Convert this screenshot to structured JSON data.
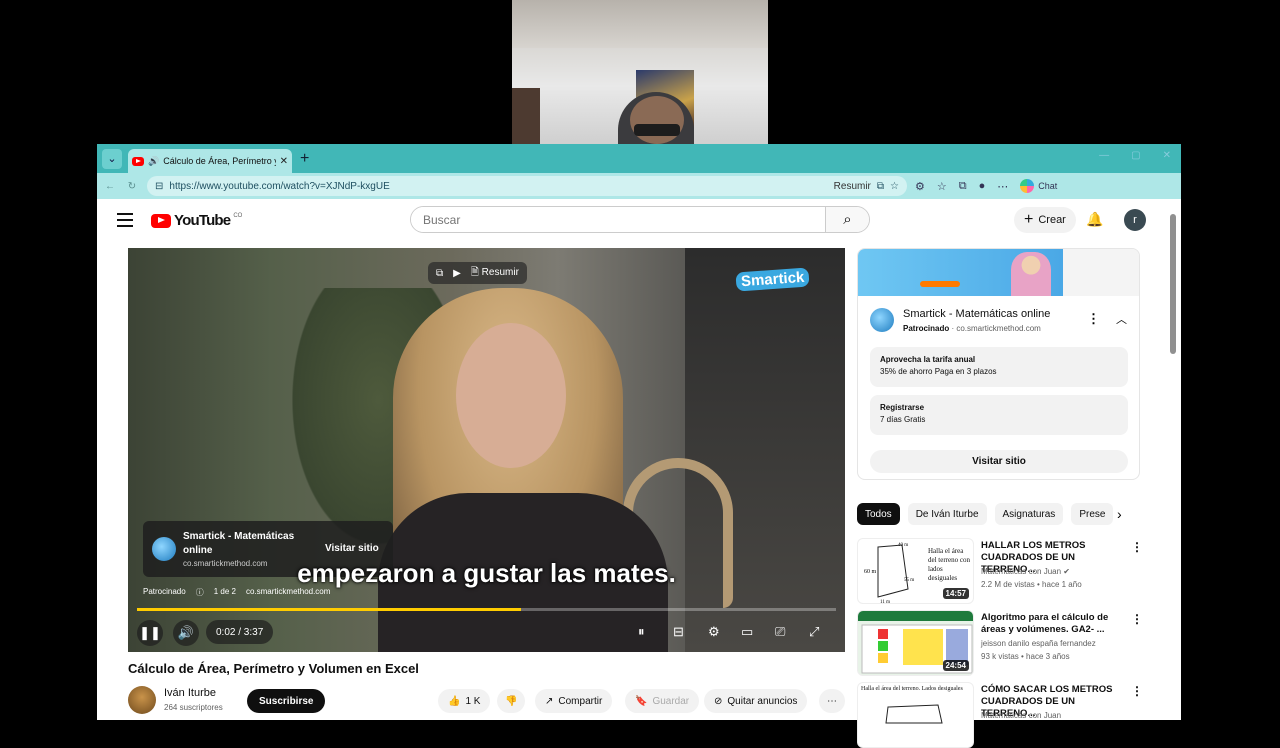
{
  "browser": {
    "tab_title": "Cálculo de Área, Perímetro y V",
    "url": "https://www.youtube.com/watch?v=XJNdP-kxgUE",
    "resumir": "Resumir",
    "chat": "Chat"
  },
  "header": {
    "logo": "YouTube",
    "logo_country": "CO",
    "search_placeholder": "Buscar",
    "create": "Crear",
    "avatar_letter": "r"
  },
  "player": {
    "overlay_resumir": "Resumir",
    "brand_logo": "Smartick",
    "ad_card": {
      "name": "Smartick - Matemáticas online",
      "url": "co.smartickmethod.com",
      "visit": "Visitar sitio"
    },
    "subtitle": "empezaron a gustar las mates.",
    "ad_info": {
      "sponsored": "Patrocinado",
      "count": "1 de 2",
      "url": "co.smartickmethod.com"
    },
    "time": "0:02 / 3:37",
    "progress": 0.55
  },
  "video": {
    "title": "Cálculo de Área, Perímetro y Volumen en Excel",
    "channel": "Iván Iturbe",
    "subscribers": "264 suscriptores",
    "subscribe": "Suscribirse",
    "likes": "1 K",
    "share": "Compartir",
    "save": "Guardar",
    "remove_ads": "Quitar anuncios"
  },
  "ad_panel": {
    "title": "Smartick - Matemáticas online",
    "sponsored": "Patrocinado",
    "url": "co.smartickmethod.com",
    "offers": [
      {
        "title": "Aprovecha la tarifa anual",
        "desc": "35% de ahorro Paga en 3 plazos"
      },
      {
        "title": "Registrarse",
        "desc": "7 días Gratis"
      }
    ],
    "visit": "Visitar sitio"
  },
  "chips": [
    "Todos",
    "De Iván Iturbe",
    "Asignaturas",
    "Prese"
  ],
  "recommendations": [
    {
      "title": "HALLAR LOS METROS CUADRADOS DE UN TERRENO...",
      "channel": "Matemáticas con Juan",
      "meta": "2.2 M de vistas • hace 1 año",
      "duration": "14:57"
    },
    {
      "title": "Algoritmo para el cálculo de áreas y volúmenes. GA2- ...",
      "channel": "jeisson danilo españa fernandez",
      "meta": "93 k vistas • hace 3 años",
      "duration": "24:54"
    },
    {
      "title": "CÓMO SACAR LOS METROS CUADRADOS DE UN TERRENO...",
      "channel": "Matemáticas con Juan",
      "meta": "",
      "duration": ""
    }
  ],
  "thumb_text": {
    "rec1_note": "Halla el área del terreno con lados desiguales",
    "rec3_note": "Halla el área del terreno. Lados desiguales"
  },
  "colors": {
    "tabbar": "#41b7b7",
    "yt_red": "#ff0000",
    "progress": "#ffcc00"
  }
}
